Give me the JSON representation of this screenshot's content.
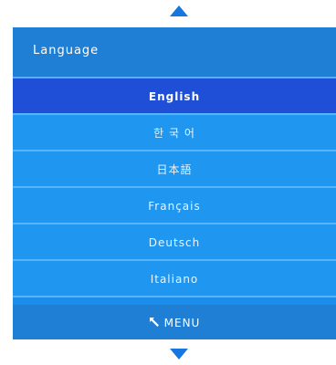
{
  "header": {
    "title": "Language"
  },
  "languages": [
    {
      "label": "English",
      "selected": true
    },
    {
      "label": "한 국 어",
      "selected": false
    },
    {
      "label": "日本語",
      "selected": false
    },
    {
      "label": "Français",
      "selected": false
    },
    {
      "label": "Deutsch",
      "selected": false
    },
    {
      "label": "Italiano",
      "selected": false
    }
  ],
  "footer": {
    "menu_label": "MENU",
    "icon": "return-arrow-icon"
  },
  "scroll": {
    "up_icon": "arrow-up-icon",
    "down_icon": "arrow-down-icon"
  },
  "colors": {
    "panel": "#1a8eea",
    "header": "#1f7fd4",
    "selected": "#1f4fd6",
    "arrow": "#1677e0"
  }
}
